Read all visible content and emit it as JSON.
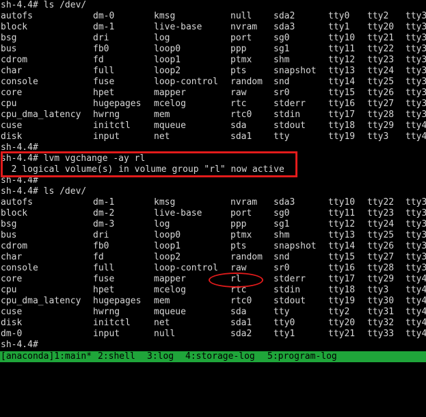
{
  "prompt": "sh-4.4#",
  "first_command": "sh-4.4# ls /dev/",
  "first_listing": [
    [
      "autofs",
      "dm-0",
      "kmsg",
      "null",
      "sda2",
      "tty0",
      "tty2",
      "tty3"
    ],
    [
      "block",
      "dm-1",
      "live-base",
      "nvram",
      "sda3",
      "tty1",
      "tty20",
      "tty3"
    ],
    [
      "bsg",
      "dri",
      "log",
      "port",
      "sg0",
      "tty10",
      "tty21",
      "tty3"
    ],
    [
      "bus",
      "fb0",
      "loop0",
      "ppp",
      "sg1",
      "tty11",
      "tty22",
      "tty3"
    ],
    [
      "cdrom",
      "fd",
      "loop1",
      "ptmx",
      "shm",
      "tty12",
      "tty23",
      "tty3"
    ],
    [
      "char",
      "full",
      "loop2",
      "pts",
      "snapshot",
      "tty13",
      "tty24",
      "tty3"
    ],
    [
      "console",
      "fuse",
      "loop-control",
      "random",
      "snd",
      "tty14",
      "tty25",
      "tty3"
    ],
    [
      "core",
      "hpet",
      "mapper",
      "raw",
      "sr0",
      "tty15",
      "tty26",
      "tty3"
    ],
    [
      "cpu",
      "hugepages",
      "mcelog",
      "rtc",
      "stderr",
      "tty16",
      "tty27",
      "tty3"
    ],
    [
      "cpu_dma_latency",
      "hwrng",
      "mem",
      "rtc0",
      "stdin",
      "tty17",
      "tty28",
      "tty3"
    ],
    [
      "cuse",
      "initctl",
      "mqueue",
      "sda",
      "stdout",
      "tty18",
      "tty29",
      "tty4"
    ],
    [
      "disk",
      "input",
      "net",
      "sda1",
      "tty",
      "tty19",
      "tty3",
      "tty4"
    ]
  ],
  "prompt_after_first": "sh-4.4#",
  "lvm_command": "sh-4.4# lvm vgchange -ay rl",
  "lvm_output": "  2 logical volume(s) in volume group \"rl\" now active",
  "prompt_after_lvm": "sh-4.4#",
  "second_command": "sh-4.4# ls /dev/",
  "second_listing": [
    [
      "autofs",
      "dm-1",
      "kmsg",
      "nvram",
      "sda3",
      "tty10",
      "tty22",
      "tty3"
    ],
    [
      "block",
      "dm-2",
      "live-base",
      "port",
      "sg0",
      "tty11",
      "tty23",
      "tty3"
    ],
    [
      "bsg",
      "dm-3",
      "log",
      "ppp",
      "sg1",
      "tty12",
      "tty24",
      "tty3"
    ],
    [
      "bus",
      "dri",
      "loop0",
      "ptmx",
      "shm",
      "tty13",
      "tty25",
      "tty3"
    ],
    [
      "cdrom",
      "fb0",
      "loop1",
      "pts",
      "snapshot",
      "tty14",
      "tty26",
      "tty3"
    ],
    [
      "char",
      "fd",
      "loop2",
      "random",
      "snd",
      "tty15",
      "tty27",
      "tty3"
    ],
    [
      "console",
      "full",
      "loop-control",
      "raw",
      "sr0",
      "tty16",
      "tty28",
      "tty3"
    ],
    [
      "core",
      "fuse",
      "mapper",
      "rl",
      "stderr",
      "tty17",
      "tty29",
      "tty4"
    ],
    [
      "cpu",
      "hpet",
      "mcelog",
      "rtc",
      "stdin",
      "tty18",
      "tty3",
      "tty4"
    ],
    [
      "cpu_dma_latency",
      "hugepages",
      "mem",
      "rtc0",
      "stdout",
      "tty19",
      "tty30",
      "tty4"
    ],
    [
      "cuse",
      "hwrng",
      "mqueue",
      "sda",
      "tty",
      "tty2",
      "tty31",
      "tty4"
    ],
    [
      "disk",
      "initctl",
      "net",
      "sda1",
      "tty0",
      "tty20",
      "tty32",
      "tty4"
    ],
    [
      "dm-0",
      "input",
      "null",
      "sda2",
      "tty1",
      "tty21",
      "tty33",
      "tty4"
    ]
  ],
  "final_prompt": "sh-4.4#",
  "statusbar": {
    "session": "[anaconda]1:main*",
    "tab2": "2:shell",
    "tab3": "3:log",
    "tab4": "4:storage-log",
    "tab5": "5:program-log"
  },
  "colors": {
    "background": "#000000",
    "text": "#d8d8d8",
    "annotation": "#e21b1b",
    "statusbar": "#1fa53a"
  }
}
